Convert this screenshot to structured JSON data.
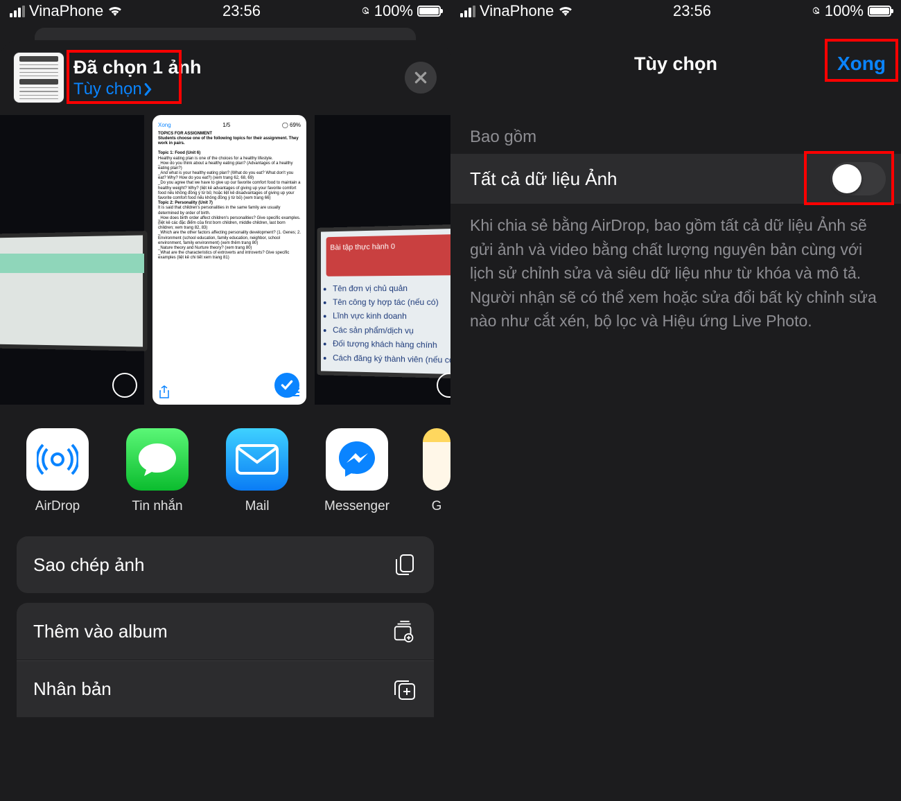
{
  "status": {
    "carrier": "VinaPhone",
    "time": "23:56",
    "battery_text": "100%"
  },
  "left": {
    "header_title": "Đã chọn 1 ảnh",
    "header_link": "Tùy chọn",
    "doc_top": {
      "done": "Xong",
      "page": "1/5"
    },
    "doc_text": {
      "t1": "TOPICS FOR ASSIGNMENT",
      "t2": "Students choose one of the following topics for their assignment. They work in pairs.",
      "h1": "Topic 1: Food (Unit 6)",
      "p1": "Healthy eating plan is one of the choices for a healthy lifestyle.",
      "p2": "_How do you think about a healthy eating plan? (Advantages of a healthy eating plan?)",
      "p3": "_And what is your healthy eating plan? (What do you eat? What don't you eat? Why? How do you eat?) (xem trang 62, 68, 69)",
      "p4": "_Do you agree that we have to give up our favorite comfort food to maintain a healthy weight? Why? (liệt kê advantages of giving up your favorite comfort food nếu không đồng ý từ bỏ; hoặc liệt kê disadvantages of giving up your favorite comfort food nếu không đồng ý từ bỏ) (xem trang 66)",
      "h2": "Topic 2: Personality (Unit 7)",
      "p5": "It is said that children's personalities in the same family are usually determined by order of birth.",
      "p6": "_How does birth order affect children's personalities? Give specific examples. (liệt kê các đặc điểm của first born children, middle children, last born children; xem trang 82, 83)",
      "p7": "_Which are the other factors affecting personality development? (1. Genes; 2. Environment (school education, family education, neighbor, school environment, family environment) (xem thêm trang 80)",
      "p8": "_Nature theory and Nurture theory? (xem trang 80)",
      "p9": "_What are the characteristics of extroverts and introverts? Give specific examples (liệt kê chi tiết xem trang 81)"
    },
    "screen3_title": "Bài tập thực hành 0",
    "screen3_bullets": [
      "Tên đơn vị chủ quản",
      "Tên công ty hợp tác (nếu có)",
      "Lĩnh vực kinh doanh",
      "Các sản phẩm/dịch vụ",
      "Đối tượng khách hàng chính",
      "Cách đăng ký thành viên (nếu có)"
    ],
    "apps": [
      "AirDrop",
      "Tin nhắn",
      "Mail",
      "Messenger",
      "G"
    ],
    "actions": [
      "Sao chép ảnh",
      "Thêm vào album",
      "Nhân bản"
    ]
  },
  "right": {
    "title": "Tùy chọn",
    "done": "Xong",
    "section": "Bao gồm",
    "row_label": "Tất cả dữ liệu Ảnh",
    "hint": "Khi chia sẻ bằng AirDrop, bao gồm tất cả dữ liệu Ảnh sẽ gửi ảnh và video bằng chất lượng nguyên bản cùng với lịch sử chỉnh sửa và siêu dữ liệu như từ khóa và mô tả. Người nhận sẽ có thể xem hoặc sửa đổi bất kỳ chỉnh sửa nào như cắt xén, bộ lọc và Hiệu ứng Live Photo."
  }
}
